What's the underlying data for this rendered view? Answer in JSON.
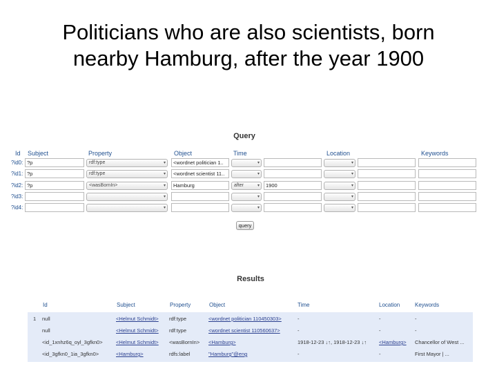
{
  "slide": {
    "title_line1": "Politicians who are also scientists, born",
    "title_line2": "nearby Hamburg, after the year 1900"
  },
  "query": {
    "heading": "Query",
    "headers": {
      "id": "Id",
      "subject": "Subject",
      "property": "Property",
      "object": "Object",
      "time": "Time",
      "location": "Location",
      "keywords": "Keywords"
    },
    "rows": [
      {
        "id": "?id0:",
        "subject": "?p",
        "property": "rdf:type",
        "object": "<wordnet politician 1..",
        "time_op": "",
        "time_value": "",
        "location_op": "",
        "location_value": "",
        "keywords": ""
      },
      {
        "id": "?id1:",
        "subject": "?p",
        "property": "rdf:type",
        "object": "<wordnet scientist 11..",
        "time_op": "",
        "time_value": "",
        "location_op": "",
        "location_value": "",
        "keywords": ""
      },
      {
        "id": "?id2:",
        "subject": "?p",
        "property": "<wasBornIn>",
        "object": "Hamburg",
        "time_op": "after",
        "time_value": "1900",
        "location_op": "",
        "location_value": "",
        "keywords": ""
      },
      {
        "id": "?id3:",
        "subject": "",
        "property": "",
        "object": "",
        "time_op": "",
        "time_value": "",
        "location_op": "",
        "location_value": "",
        "keywords": ""
      },
      {
        "id": "?id4:",
        "subject": "",
        "property": "",
        "object": "",
        "time_op": "",
        "time_value": "",
        "location_op": "",
        "location_value": "",
        "keywords": ""
      }
    ],
    "button_label": "query"
  },
  "results": {
    "heading": "Results",
    "headers": {
      "id": "Id",
      "subject": "Subject",
      "property": "Property",
      "object": "Object",
      "time": "Time",
      "location": "Location",
      "keywords": "Keywords"
    },
    "rows": [
      {
        "num": "1",
        "id": "null",
        "subject": "<Helmut Schmidt>",
        "property": "rdf:type",
        "object": "<wordnet politician 110450303>",
        "time": "-",
        "location": "-",
        "keywords": "-"
      },
      {
        "num": "",
        "id": "null",
        "subject": "<Helmut Schmidt>",
        "property": "rdf:type",
        "object": "<wordnet scientist 110560637>",
        "time": "-",
        "location": "-",
        "keywords": "-"
      },
      {
        "num": "",
        "id": "<id_1xnhz6q_oyl_3gfkn0>",
        "subject": "<Helmut Schmidt>",
        "property": "<wasBornIn>",
        "object": "<Hamburg>",
        "time": "1918-12-23 ↓↑, 1918-12-23 ↓↑",
        "location": "<Hamburg>",
        "keywords": "Chancellor of West ..."
      },
      {
        "num": "",
        "id": "<id_3gfkn0_1ia_3gfkn0>",
        "subject": "<Hamburg>",
        "property": "rdfs:label",
        "object": "\"Hamburg\"@eng",
        "time": "-",
        "location": "-",
        "keywords": "First Mayor | ..."
      }
    ]
  },
  "colors": {
    "header_text": "#1f4f8f",
    "results_band": "#e4ebf8",
    "link": "#2a3f8f"
  }
}
